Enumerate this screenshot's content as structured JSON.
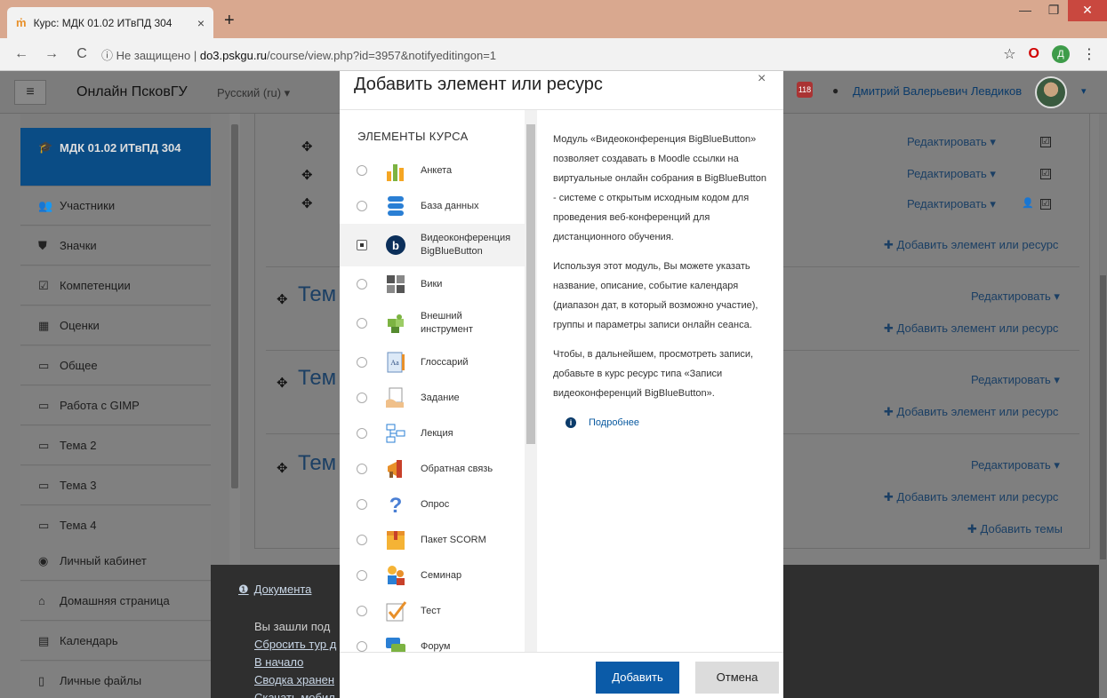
{
  "browser": {
    "tab_title": "Курс: МДК 01.02 ИТвПД 304",
    "tab_close": "×",
    "newtab": "+",
    "url_prefix": "Не защищено",
    "url_host": "do3.pskgu.ru",
    "url_path": "/course/view.php?id=3957&notifyeditingon=1",
    "profile_letter": "Д",
    "nav_back": "←",
    "nav_forward": "→",
    "nav_reload": "C",
    "info_icon": "ⓘ",
    "star": "☆",
    "opera": "O",
    "menu": "⋮",
    "win_min": "—",
    "win_max": "❐",
    "win_close": "✕"
  },
  "navbar": {
    "menu_icon": "≡",
    "site_name": "Онлайн ПсковГУ",
    "language": "Русский (ru) ▾",
    "notifications": "118",
    "message_icon": "●",
    "user_name": "Дмитрий Валерьевич Левдиков",
    "user_caret": "▾"
  },
  "sidebar": {
    "items": [
      {
        "icon": "🎓",
        "label": "МДК 01.02 ИТвПД 304"
      },
      {
        "icon": "👥",
        "label": "Участники"
      },
      {
        "icon": "⛊",
        "label": "Значки"
      },
      {
        "icon": "☑",
        "label": "Компетенции"
      },
      {
        "icon": "▦",
        "label": "Оценки"
      },
      {
        "icon": "▭",
        "label": "Общее"
      },
      {
        "icon": "▭",
        "label": "Работа с GIMP"
      },
      {
        "icon": "▭",
        "label": "Тема 2"
      },
      {
        "icon": "▭",
        "label": "Тема 3"
      },
      {
        "icon": "▭",
        "label": "Тема 4"
      },
      {
        "icon": "◉",
        "label": "Личный кабинет"
      },
      {
        "icon": "⌂",
        "label": "Домашняя страница"
      },
      {
        "icon": "▤",
        "label": "Календарь"
      },
      {
        "icon": "▯",
        "label": "Личные файлы"
      }
    ]
  },
  "course": {
    "edit_label": "Редактировать ▾",
    "add_label": "Добавить элемент или ресурс",
    "add_topics": "Добавить темы",
    "topic_prefix": "Тем",
    "plus": "✚",
    "move": "✥",
    "check": "☑",
    "person": "👤"
  },
  "footer": {
    "doc_link": "Документа",
    "info_icon": "❶",
    "logged_as": "Вы зашли под",
    "reset_tour": "Сбросить тур д",
    "home": "В начало",
    "storage": "Сводка хранен",
    "mobile": "Скачать мобил"
  },
  "modal": {
    "title": "Добавить элемент или ресурс",
    "close": "×",
    "section_header": "ЭЛЕМЕНТЫ КУРСА",
    "options": [
      {
        "label": "Анкета",
        "icon": "bar-chart-icon"
      },
      {
        "label": "База данных",
        "icon": "database-icon"
      },
      {
        "label": "Видеоконференция BigBlueButton",
        "icon": "bigbluebutton-icon",
        "selected": true
      },
      {
        "label": "Вики",
        "icon": "wiki-icon"
      },
      {
        "label": "Внешний инструмент",
        "icon": "puzzle-icon"
      },
      {
        "label": "Глоссарий",
        "icon": "glossary-icon"
      },
      {
        "label": "Задание",
        "icon": "assignment-icon"
      },
      {
        "label": "Лекция",
        "icon": "lesson-icon"
      },
      {
        "label": "Обратная связь",
        "icon": "megaphone-icon"
      },
      {
        "label": "Опрос",
        "icon": "question-icon"
      },
      {
        "label": "Пакет SCORM",
        "icon": "scorm-icon"
      },
      {
        "label": "Семинар",
        "icon": "workshop-icon"
      },
      {
        "label": "Тест",
        "icon": "quiz-icon"
      },
      {
        "label": "Форум",
        "icon": "forum-icon"
      }
    ],
    "description": [
      "Модуль «Видеоконференция BigBlueButton» позволяет создавать в Moodle ссылки на виртуальные онлайн собрания в BigBlueButton - системе с открытым исходным кодом для проведения веб-конференций для дистанционного обучения.",
      "Используя этот модуль, Вы можете указать название, описание, событие календаря (диапазон дат, в который возможно участие), группы и параметры записи онлайн сеанса.",
      "Чтобы, в дальнейшем, просмотреть записи, добавьте в курс ресурс типа «Записи видеоконференций BigBlueButton»."
    ],
    "more_icon": "i",
    "more_link": "Подробнее",
    "add_button": "Добавить",
    "cancel_button": "Отмена"
  }
}
